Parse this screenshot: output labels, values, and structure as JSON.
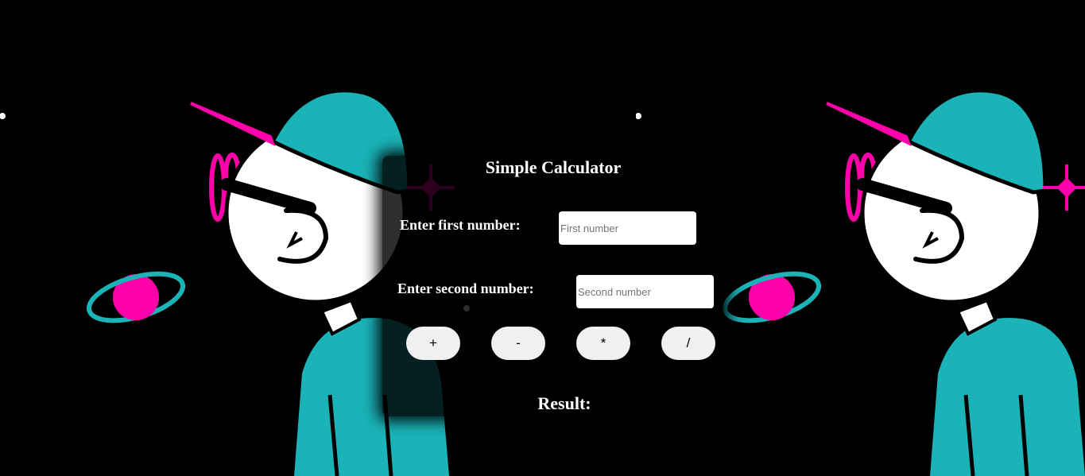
{
  "colors": {
    "background": "#000000",
    "teal": "#1ab3b8",
    "magenta": "#ff00aa",
    "white": "#ffffff",
    "button": "#f0f0f0"
  },
  "calculator": {
    "title": "Simple Calculator",
    "first_label": "Enter first number:",
    "first_placeholder": "First number",
    "first_value": "",
    "second_label": "Enter second number:",
    "second_placeholder": "Second number",
    "second_value": "",
    "buttons": [
      {
        "label": "+",
        "name": "add-button"
      },
      {
        "label": "-",
        "name": "subtract-button"
      },
      {
        "label": "*",
        "name": "multiply-button"
      },
      {
        "label": "/",
        "name": "divide-button"
      }
    ],
    "result_label": "Result:"
  },
  "background": {
    "illustration": "cartoon-person-with-cap-and-planet",
    "repeat_count": 2
  }
}
